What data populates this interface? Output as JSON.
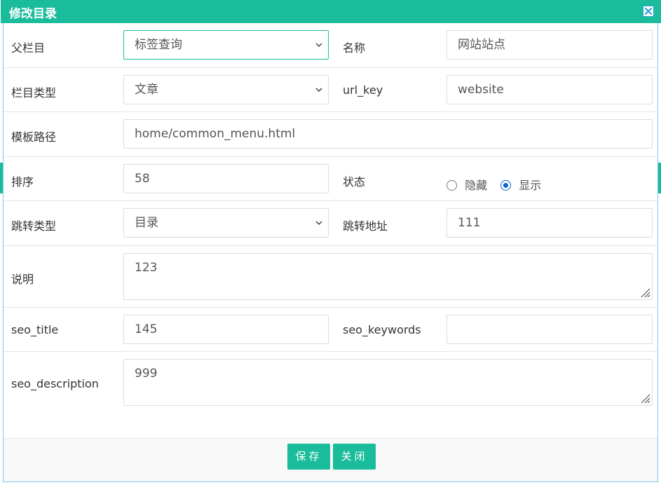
{
  "dialog": {
    "title": "修改目录",
    "close_icon": "close-icon"
  },
  "form": {
    "parent": {
      "label": "父栏目",
      "value": "标签查询"
    },
    "name": {
      "label": "名称",
      "value": "网站站点"
    },
    "column_type": {
      "label": "栏目类型",
      "value": "文章"
    },
    "url_key": {
      "label": "url_key",
      "value": "website"
    },
    "template_path": {
      "label": "模板路径",
      "value": "home/common_menu.html"
    },
    "sort": {
      "label": "排序",
      "value": "58"
    },
    "status": {
      "label": "状态",
      "options": [
        "隐藏",
        "显示"
      ],
      "selected": "显示"
    },
    "jump_type": {
      "label": "跳转类型",
      "value": "目录"
    },
    "jump_address": {
      "label": "跳转地址",
      "value": "111"
    },
    "description": {
      "label": "说明",
      "value": "123"
    },
    "seo_title": {
      "label": "seo_title",
      "value": "145"
    },
    "seo_keywords": {
      "label": "seo_keywords",
      "value": ""
    },
    "seo_description": {
      "label": "seo_description",
      "value": "999"
    }
  },
  "footer": {
    "save_label": "保存",
    "close_label": "关闭"
  },
  "colors": {
    "accent": "#1abc9c",
    "border": "#dcdcdc",
    "radio_checked": "#0b63d6"
  }
}
